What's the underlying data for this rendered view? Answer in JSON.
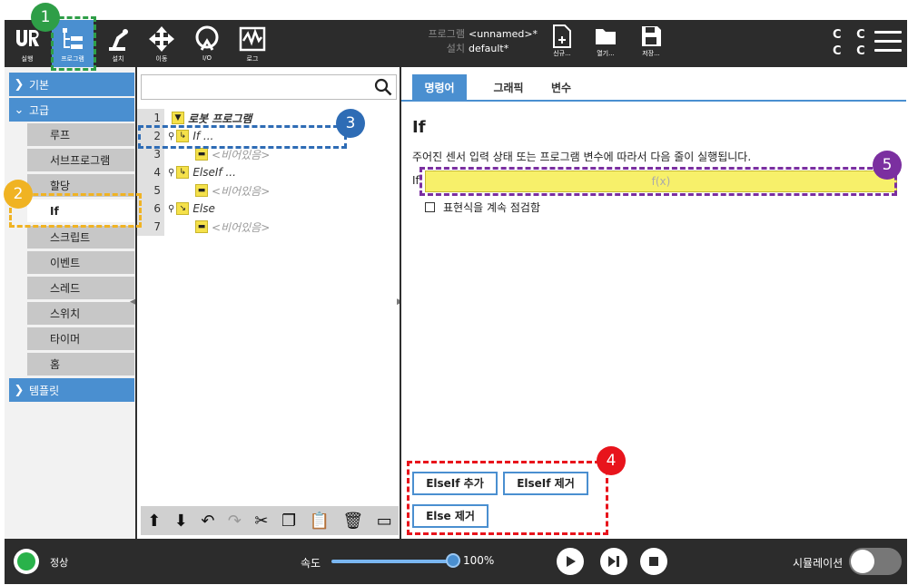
{
  "toolbar": {
    "run_label": "실행",
    "program_label": "프로그램",
    "installation_label": "설치",
    "move_label": "이동",
    "io_label": "I/O",
    "log_label": "로그",
    "program_key": "프로그램",
    "program_value": "<unnamed>*",
    "installation_key": "설치",
    "installation_value": "default*",
    "new_label": "신규...",
    "open_label": "열기...",
    "save_label": "저장...",
    "cc_top": "C C",
    "cc_bottom": "C C"
  },
  "left_panel": {
    "basic": "기본",
    "advanced": "고급",
    "items": [
      "루프",
      "서브프로그램",
      "할당",
      "If",
      "스크립트",
      "이벤트",
      "스레드",
      "스위치",
      "타이머",
      "홈"
    ],
    "templates": "템플릿"
  },
  "tree": {
    "rows": [
      {
        "num": "1",
        "text": "로봇 프로그램"
      },
      {
        "num": "2",
        "text": "If ..."
      },
      {
        "num": "3",
        "text": "<비어있음>"
      },
      {
        "num": "4",
        "text": "ElseIf ..."
      },
      {
        "num": "5",
        "text": "<비어있음>"
      },
      {
        "num": "6",
        "text": "Else"
      },
      {
        "num": "7",
        "text": "<비어있음>"
      }
    ]
  },
  "right_panel": {
    "tabs": [
      "명령어",
      "그래픽",
      "변수"
    ],
    "title": "If",
    "description": "주어진 센서 입력 상태 또는 프로그램 변수에 따라서 다음 줄이 실행됩니다.",
    "if_label": "If",
    "expression_placeholder": "f(x)",
    "checkbox_label": "표현식을 계속 점검함",
    "add_elseif": "ElseIf 추가",
    "remove_elseif": "ElseIf 제거",
    "remove_else": "Else 제거"
  },
  "footer": {
    "status": "정상",
    "speed_label": "속도",
    "speed_value": "100%",
    "speed_fraction": 1.0,
    "simulation_label": "시뮬레이션"
  },
  "annotations": {
    "a1": "1",
    "a2": "2",
    "a3": "3",
    "a4": "4",
    "a5": "5"
  },
  "colors": {
    "accent": "#4a8fd0",
    "ann1": "#2e9e47",
    "ann2": "#f0b323",
    "ann3": "#2e6cb5",
    "ann4": "#e8141c",
    "ann5": "#7b2fa0"
  }
}
